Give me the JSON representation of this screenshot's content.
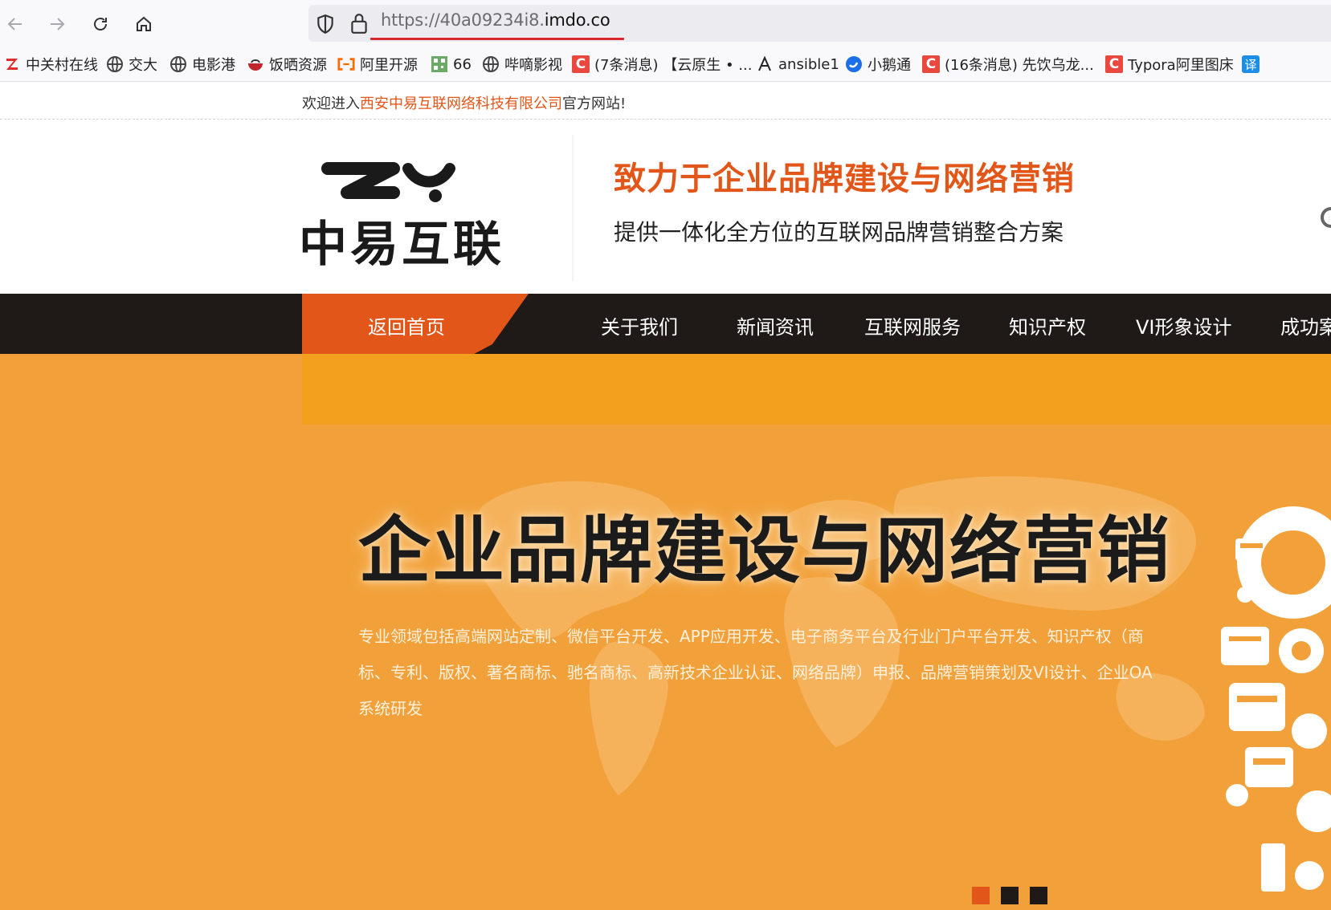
{
  "browser": {
    "url_prefix": "https://40a09234i8.",
    "url_domain": "imdo.co",
    "bookmarks": [
      {
        "label": "中关村在线",
        "icon": "zol-icon"
      },
      {
        "label": "交大",
        "icon": "globe-icon"
      },
      {
        "label": "电影港",
        "icon": "globe-icon"
      },
      {
        "label": "饭晒资源",
        "icon": "bowl-icon"
      },
      {
        "label": "阿里开源",
        "icon": "aliyun-icon"
      },
      {
        "label": "66",
        "icon": "qr-icon"
      },
      {
        "label": "哔嘀影视",
        "icon": "globe-icon"
      },
      {
        "label": "(7条消息) 【云原生 • ...",
        "icon": "csdn-icon"
      },
      {
        "label": "ansible1",
        "icon": "ansible-icon"
      },
      {
        "label": "小鹅通",
        "icon": "xiaoe-icon"
      },
      {
        "label": "(16条消息) 先饮乌龙...",
        "icon": "csdn-icon"
      },
      {
        "label": "Typora阿里图床",
        "icon": "csdn-icon"
      },
      {
        "label": "译",
        "icon": "translate-icon"
      }
    ]
  },
  "page": {
    "welcome_prefix": "欢迎进入",
    "company": "西安中易互联网络科技有限公司",
    "welcome_suffix": "官方网站!",
    "logo_text": "中易互联",
    "slogan_main": "致力于企业品牌建设与网络营销",
    "slogan_sub": "提供一体化全方位的互联网品牌营销整合方案",
    "nav": [
      "返回首页",
      "关于我们",
      "新闻资讯",
      "互联网服务",
      "知识产权",
      "VI形象设计",
      "成功案"
    ],
    "banner": {
      "title": "企业品牌建设与网络营销",
      "desc": "专业领域包括高端网站定制、微信平台开发、APP应用开发、电子商务平台及行业门户平台开发、知识产权（商标、专利、版权、著名商标、驰名商标、高新技术企业认证、网络品牌）申报、品牌营销策划及VI设计、企业OA系统研发"
    },
    "slides": {
      "count": 3,
      "active": 0
    }
  },
  "colors": {
    "accent": "#e2561a",
    "nav_bg": "#1f1a18",
    "banner_bg": "#f2a13a"
  }
}
